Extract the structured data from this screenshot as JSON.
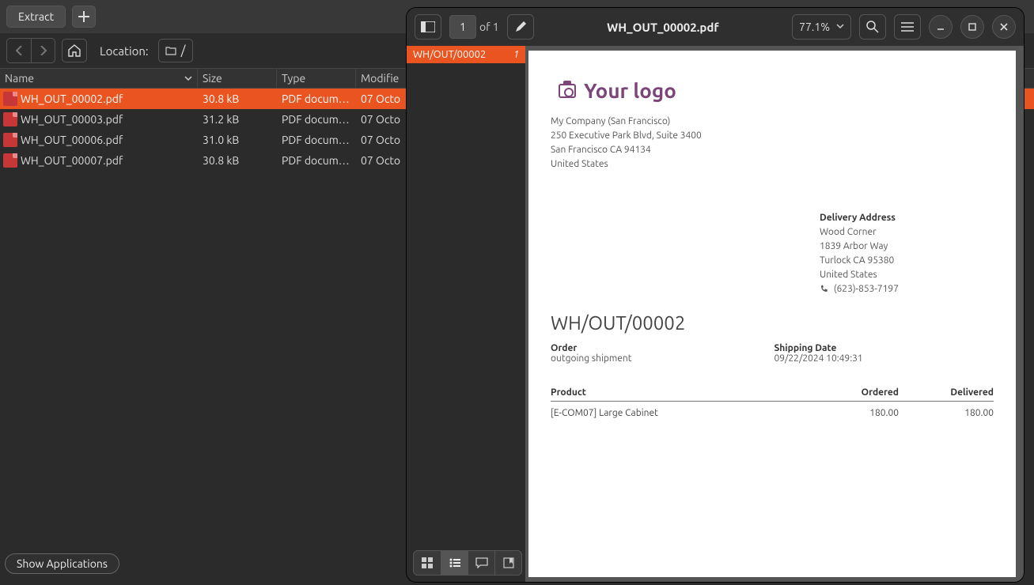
{
  "file_manager": {
    "extract_label": "Extract",
    "location_label": "Location:",
    "path": "/",
    "columns": {
      "name": "Name",
      "size": "Size",
      "type": "Type",
      "modified": "Modifie"
    },
    "files": [
      {
        "name": "WH_OUT_00002.pdf",
        "size": "30.8 kB",
        "type": "PDF docum…",
        "modified": "07 Octo",
        "selected": true
      },
      {
        "name": "WH_OUT_00003.pdf",
        "size": "31.2 kB",
        "type": "PDF docum…",
        "modified": "07 Octo",
        "selected": false
      },
      {
        "name": "WH_OUT_00006.pdf",
        "size": "31.0 kB",
        "type": "PDF docum…",
        "modified": "07 Octo",
        "selected": false
      },
      {
        "name": "WH_OUT_00007.pdf",
        "size": "30.8 kB",
        "type": "PDF docum…",
        "modified": "07 Octo",
        "selected": false
      }
    ],
    "show_apps_label": "Show Applications"
  },
  "pdf_viewer": {
    "title": "WH_OUT_00002.pdf",
    "page_current": "1",
    "page_of": "of 1",
    "zoom": "77.1%",
    "thumb_tab": {
      "name": "WH/OUT/00002",
      "page": "1"
    }
  },
  "document": {
    "logo_text": "Your logo",
    "company": {
      "name": "My Company (San Francisco)",
      "addr1": "250 Executive Park Blvd, Suite 3400",
      "addr2": "San Francisco CA 94134",
      "country": "United States"
    },
    "delivery": {
      "header": "Delivery Address",
      "name": "Wood Corner",
      "addr1": "1839 Arbor Way",
      "addr2": "Turlock CA 95380",
      "country": "United States",
      "phone": "(623)-853-7197"
    },
    "doc_name": "WH/OUT/00002",
    "order_label": "Order",
    "order_value": "outgoing shipment",
    "ship_label": "Shipping Date",
    "ship_value": "09/22/2024 10:49:31",
    "table": {
      "h1": "Product",
      "h2": "Ordered",
      "h3": "Delivered",
      "rows": [
        {
          "product": "[E-COM07] Large Cabinet",
          "ordered": "180.00",
          "delivered": "180.00"
        }
      ]
    }
  }
}
